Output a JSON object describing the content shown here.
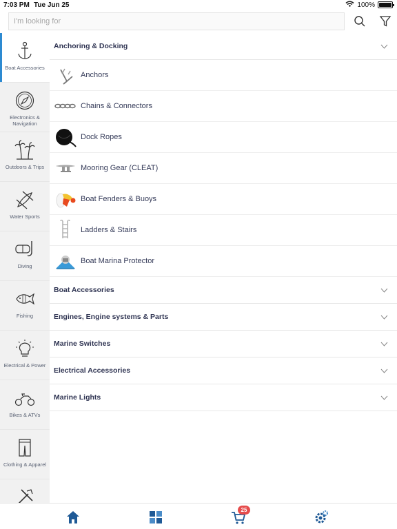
{
  "status_bar": {
    "time": "7:03 PM",
    "date": "Tue Jun 25",
    "battery": "100%"
  },
  "search": {
    "placeholder": "I'm looking for"
  },
  "top_icons": [
    "search-icon",
    "filter-icon"
  ],
  "sidebar": {
    "items": [
      {
        "label": "Boat Accessories",
        "icon": "anchor-icon",
        "active": true
      },
      {
        "label": "Electronics & Navigation",
        "icon": "compass-icon"
      },
      {
        "label": "Outdoors & Trips",
        "icon": "palm-trees-icon"
      },
      {
        "label": "Water Sports",
        "icon": "kayak-icon"
      },
      {
        "label": "Diving",
        "icon": "dive-mask-icon"
      },
      {
        "label": "Fishing",
        "icon": "fish-icon"
      },
      {
        "label": "Electrical & Power",
        "icon": "lightbulb-icon"
      },
      {
        "label": "Bikes & ATVs",
        "icon": "atv-icon"
      },
      {
        "label": "Clothing & Apparel",
        "icon": "apparel-icon"
      },
      {
        "label": "",
        "icon": "tools-icon"
      }
    ]
  },
  "categories": [
    {
      "label": "Anchoring & Docking",
      "expanded": true,
      "children": [
        {
          "label": "Anchors",
          "icon": "anchor-image"
        },
        {
          "label": "Chains & Connectors",
          "icon": "chain-image"
        },
        {
          "label": "Dock Ropes",
          "icon": "rope-image"
        },
        {
          "label": "Mooring Gear (CLEAT)",
          "icon": "cleat-image"
        },
        {
          "label": "Boat Fenders & Buoys",
          "icon": "fender-image"
        },
        {
          "label": "Ladders & Stairs",
          "icon": "ladder-image"
        },
        {
          "label": "Boat Marina Protector",
          "icon": "marina-protector-image"
        }
      ]
    },
    {
      "label": "Boat Accessories",
      "expanded": false
    },
    {
      "label": "Engines, Engine systems & Parts",
      "expanded": false
    },
    {
      "label": "Marine Switches",
      "expanded": false
    },
    {
      "label": "Electrical Accessories",
      "expanded": false
    },
    {
      "label": "Marine Lights",
      "expanded": false
    }
  ],
  "bottom_tabs": [
    {
      "icon": "home-icon"
    },
    {
      "icon": "categories-icon"
    },
    {
      "icon": "cart-icon",
      "badge": "25"
    },
    {
      "icon": "settings-icon"
    }
  ],
  "colors": {
    "accent": "#2d8ad1",
    "badge": "#e64c4c",
    "text": "#303553"
  }
}
